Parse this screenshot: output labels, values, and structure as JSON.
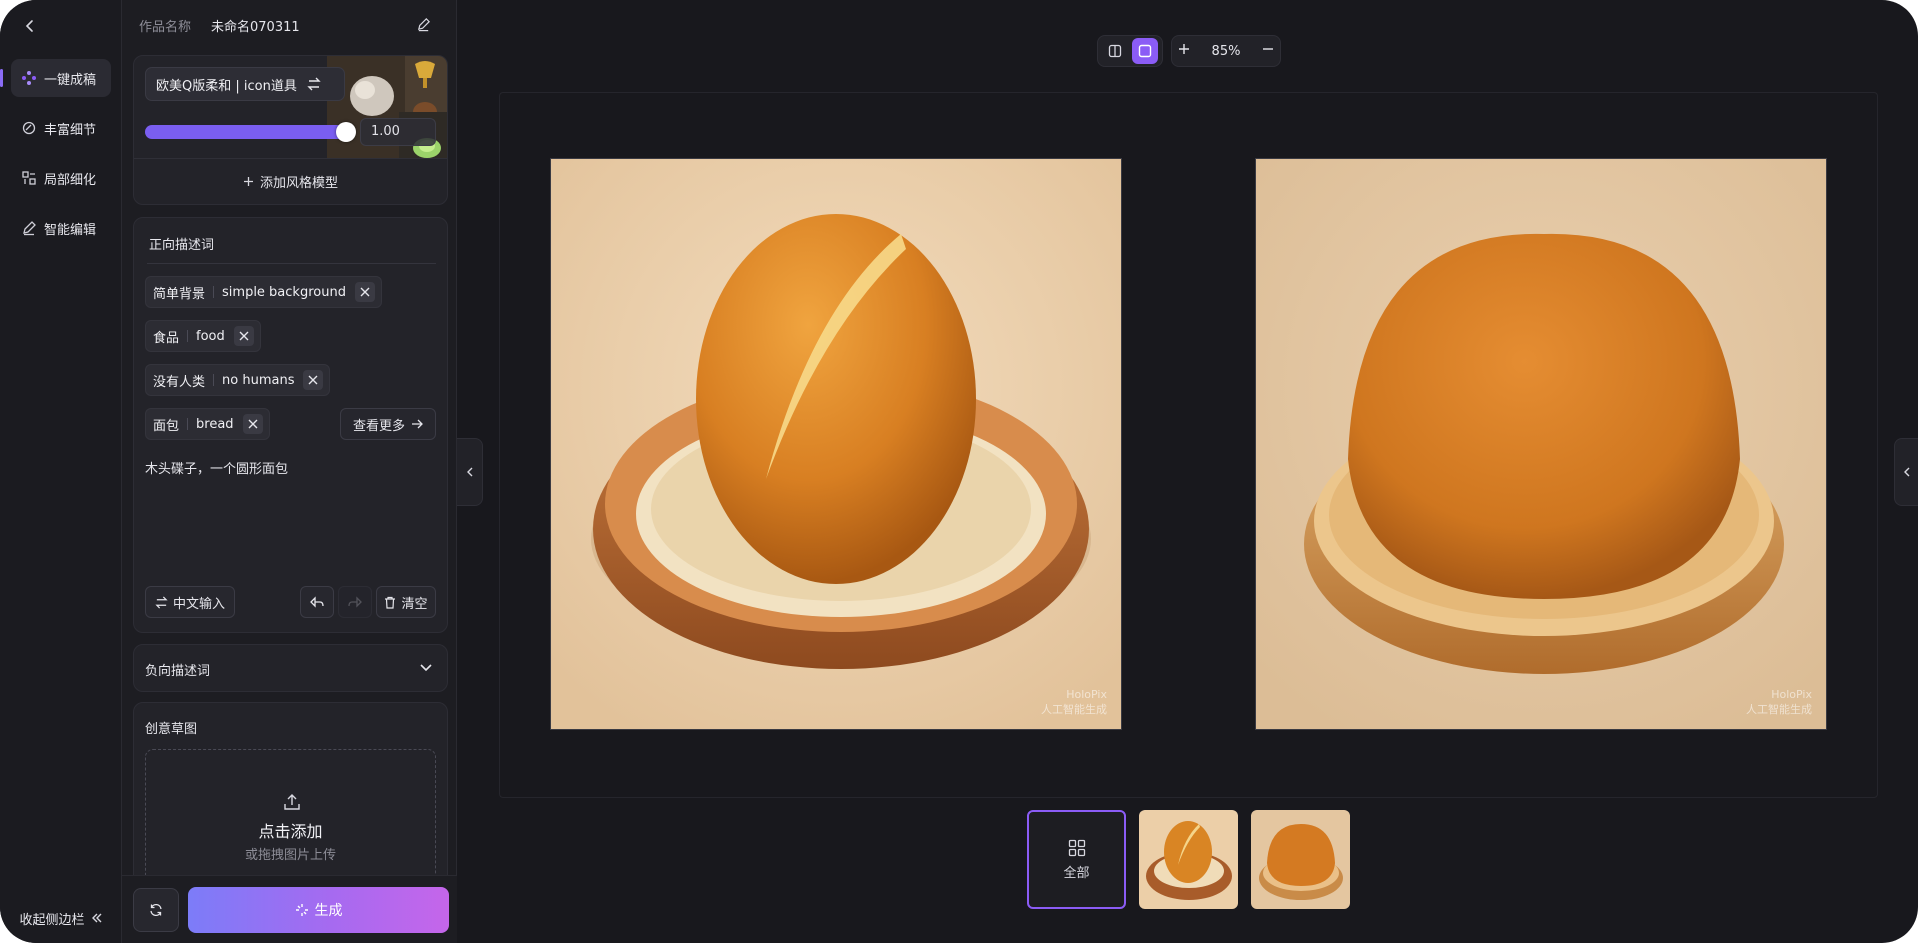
{
  "colors": {
    "background": "#18181d",
    "panel": "#1d1d22",
    "accent": "#8b5cf6",
    "generate_gradient_start": "#7c7cf8",
    "generate_gradient_end": "#c566ea"
  },
  "nav": {
    "back_icon": "chevron-left-icon",
    "items": [
      {
        "label": "一键成稿",
        "icon": "magic-dots-icon",
        "active": true
      },
      {
        "label": "丰富细节",
        "icon": "detail-circle-icon",
        "active": false
      },
      {
        "label": "局部细化",
        "icon": "grid-refine-icon",
        "active": false
      },
      {
        "label": "智能编辑",
        "icon": "pen-icon",
        "active": false
      }
    ],
    "collapse_label": "收起侧边栏"
  },
  "work": {
    "name_label": "作品名称",
    "name_value": "未命名070311"
  },
  "style_model": {
    "name": "欧美Q版柔和 | icon道具",
    "weight": "1.00",
    "weight_fraction": 1.0,
    "add_label": "添加风格模型"
  },
  "positive_prompt": {
    "title": "正向描述词",
    "tags": [
      {
        "zh": "简单背景",
        "en": "simple background"
      },
      {
        "zh": "食品",
        "en": "food"
      },
      {
        "zh": "没有人类",
        "en": "no humans"
      },
      {
        "zh": "面包",
        "en": "bread"
      }
    ],
    "see_more_label": "查看更多",
    "text": "木头碟子，一个圆形面包",
    "chinese_input_label": "中文输入",
    "clear_label": "清空"
  },
  "negative_prompt": {
    "title": "负向描述词"
  },
  "sketch": {
    "title": "创意草图",
    "upload_main": "点击添加",
    "upload_sub": "或拖拽图片上传"
  },
  "generate_label": "生成",
  "toolbar": {
    "zoom": "85%"
  },
  "results": {
    "watermark_line1": "HoloPix",
    "watermark_line2": "人工智能生成"
  },
  "thumbnails": {
    "all_label": "全部"
  }
}
